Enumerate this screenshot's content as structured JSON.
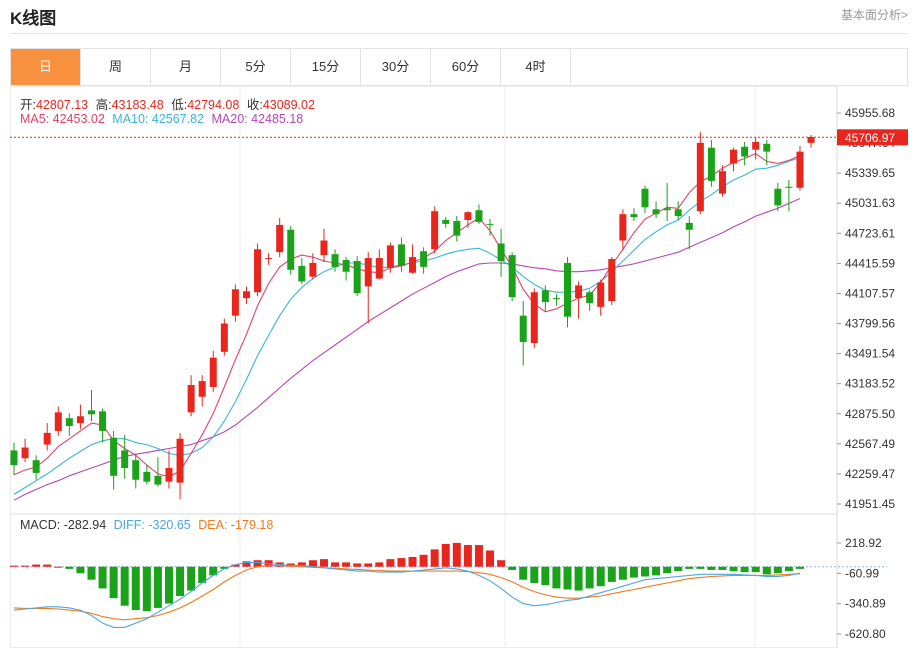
{
  "header": {
    "title": "K线图",
    "link": "基本面分析>"
  },
  "tabs": [
    {
      "label": "日",
      "active": true
    },
    {
      "label": "周"
    },
    {
      "label": "月"
    },
    {
      "label": "5分"
    },
    {
      "label": "15分"
    },
    {
      "label": "30分"
    },
    {
      "label": "60分"
    },
    {
      "label": "4时"
    }
  ],
  "ohlc_legend": {
    "open_label": "开:",
    "open": "42807.13",
    "high_label": "高:",
    "high": "43183.48",
    "low_label": "低:",
    "low": "42794.08",
    "close_label": "收:",
    "close": "43089.02"
  },
  "ma_legend": {
    "ma5": "MA5: 42453.02",
    "ma10": "MA10: 42567.82",
    "ma20": "MA20: 42485.18"
  },
  "macd_legend": {
    "macd": "MACD: -282.94",
    "diff": "DIFF: -320.65",
    "dea": "DEA: -179.18"
  },
  "colors": {
    "up": "#e8261e",
    "down": "#1aa21a",
    "ma5": "#e0426a",
    "ma10": "#38b6d8",
    "ma20": "#b547b5",
    "dea": "#f07b1e",
    "diff": "#4aa8e0",
    "accent": "#f7913f"
  },
  "chart_data": {
    "type": "candlestick",
    "price_axis": {
      "ticks": [
        "45955.68",
        "45647.64",
        "45339.65",
        "45031.63",
        "44723.61",
        "44415.59",
        "44107.57",
        "43799.56",
        "43491.54",
        "43183.52",
        "42875.50",
        "42567.49",
        "42259.47",
        "41951.45"
      ],
      "range": [
        41951.45,
        45955.68
      ]
    },
    "last_price_label": "45706.97",
    "last_price": 45706.97,
    "candles": [
      [
        42500,
        42350,
        42580,
        42250
      ],
      [
        42420,
        42530,
        42620,
        42380
      ],
      [
        42400,
        42270,
        42450,
        42200
      ],
      [
        42560,
        42680,
        42780,
        42500
      ],
      [
        42700,
        42890,
        42950,
        42650
      ],
      [
        42830,
        42750,
        42880,
        42650
      ],
      [
        42780,
        42850,
        42970,
        42720
      ],
      [
        42910,
        42870,
        43120,
        42800
      ],
      [
        42900,
        42700,
        42930,
        42580
      ],
      [
        42630,
        42240,
        42700,
        42100
      ],
      [
        42500,
        42320,
        42660,
        42210
      ],
      [
        42400,
        42200,
        42470,
        42110
      ],
      [
        42280,
        42180,
        42350,
        42150
      ],
      [
        42240,
        42150,
        42430,
        42130
      ],
      [
        42180,
        42320,
        42500,
        42110
      ],
      [
        42170,
        42620,
        42680,
        42000
      ],
      [
        42890,
        43170,
        43270,
        42850
      ],
      [
        43050,
        43210,
        43270,
        42950
      ],
      [
        43150,
        43450,
        43520,
        43100
      ],
      [
        43510,
        43800,
        43850,
        43470
      ],
      [
        43880,
        44150,
        44200,
        43820
      ],
      [
        44060,
        44130,
        44180,
        44000
      ],
      [
        44120,
        44560,
        44620,
        44080
      ],
      [
        44470,
        44470,
        44520,
        44400
      ],
      [
        44530,
        44810,
        44880,
        44480
      ],
      [
        44760,
        44350,
        44800,
        44300
      ],
      [
        44390,
        44230,
        44470,
        44200
      ],
      [
        44280,
        44420,
        44520,
        44250
      ],
      [
        44500,
        44650,
        44770,
        44430
      ],
      [
        44510,
        44380,
        44560,
        44330
      ],
      [
        44450,
        44330,
        44480,
        44240
      ],
      [
        44440,
        44110,
        44490,
        44080
      ],
      [
        44180,
        44470,
        44530,
        43800
      ],
      [
        44260,
        44470,
        44560,
        44250
      ],
      [
        44370,
        44600,
        44630,
        44320
      ],
      [
        44610,
        44390,
        44680,
        44330
      ],
      [
        44320,
        44480,
        44610,
        44310
      ],
      [
        44540,
        44380,
        44580,
        44310
      ],
      [
        44560,
        44950,
        45000,
        44520
      ],
      [
        44860,
        44820,
        44890,
        44780
      ],
      [
        44850,
        44700,
        44900,
        44640
      ],
      [
        44860,
        44940,
        44950,
        44780
      ],
      [
        44960,
        44840,
        45020,
        44820
      ],
      [
        44820,
        44810,
        44870,
        44700
      ],
      [
        44620,
        44440,
        44770,
        44280
      ],
      [
        44500,
        44070,
        44530,
        44030
      ],
      [
        43880,
        43610,
        44030,
        43370
      ],
      [
        43600,
        44120,
        44160,
        43550
      ],
      [
        44140,
        44020,
        44190,
        43920
      ],
      [
        44060,
        44050,
        44100,
        43980
      ],
      [
        44420,
        43870,
        44480,
        43760
      ],
      [
        44060,
        44190,
        44230,
        43850
      ],
      [
        44120,
        44010,
        44140,
        43930
      ],
      [
        43970,
        44220,
        44250,
        43880
      ],
      [
        44030,
        44460,
        44480,
        43990
      ],
      [
        44650,
        44920,
        44970,
        44550
      ],
      [
        44920,
        44890,
        44980,
        44850
      ],
      [
        45180,
        44990,
        45210,
        44930
      ],
      [
        44970,
        44920,
        45050,
        44880
      ],
      [
        44980,
        44960,
        45240,
        44850
      ],
      [
        44970,
        44900,
        45050,
        44860
      ],
      [
        44830,
        44760,
        44900,
        44560
      ],
      [
        44950,
        45650,
        45760,
        44920
      ],
      [
        45600,
        45260,
        45680,
        45200
      ],
      [
        45130,
        45360,
        45420,
        45100
      ],
      [
        45440,
        45580,
        45600,
        45360
      ],
      [
        45610,
        45510,
        45660,
        45420
      ],
      [
        45580,
        45660,
        45700,
        45480
      ],
      [
        45640,
        45560,
        45680,
        45420
      ],
      [
        45180,
        45010,
        45240,
        44950
      ],
      [
        45200,
        45190,
        45270,
        44950
      ],
      [
        45190,
        45560,
        45620,
        45160
      ],
      [
        45650,
        45710,
        45730,
        45600
      ]
    ],
    "ma5": [
      42250,
      42300,
      42330,
      42420,
      42540,
      42620,
      42700,
      42780,
      42760,
      42600,
      42520,
      42450,
      42350,
      42260,
      42230,
      42290,
      42470,
      42660,
      42880,
      43150,
      43430,
      43690,
      43980,
      44210,
      44380,
      44460,
      44500,
      44480,
      44440,
      44420,
      44400,
      44360,
      44330,
      44320,
      44370,
      44390,
      44430,
      44470,
      44540,
      44650,
      44730,
      44810,
      44880,
      44750,
      44560,
      44380,
      44150,
      44000,
      43920,
      43950,
      44010,
      44060,
      44090,
      44220,
      44400,
      44560,
      44730,
      44870,
      44930,
      44990,
      44980,
      45140,
      45250,
      45310,
      45390,
      45450,
      45490,
      45540,
      45460,
      45440,
      45470,
      45520
    ],
    "ma10": [
      42050,
      42120,
      42190,
      42260,
      42340,
      42420,
      42490,
      42560,
      42600,
      42620,
      42620,
      42580,
      42560,
      42520,
      42470,
      42450,
      42470,
      42530,
      42640,
      42800,
      43000,
      43230,
      43470,
      43680,
      43880,
      44050,
      44170,
      44260,
      44330,
      44380,
      44420,
      44420,
      44400,
      44370,
      44380,
      44400,
      44420,
      44440,
      44470,
      44510,
      44540,
      44560,
      44570,
      44520,
      44450,
      44380,
      44280,
      44200,
      44140,
      44120,
      44120,
      44130,
      44160,
      44230,
      44330,
      44440,
      44550,
      44660,
      44740,
      44810,
      44860,
      44960,
      45050,
      45120,
      45200,
      45270,
      45320,
      45380,
      45390,
      45420,
      45460,
      45500
    ],
    "ma20": [
      41990,
      42050,
      42100,
      42150,
      42190,
      42240,
      42280,
      42320,
      42360,
      42400,
      42440,
      42460,
      42480,
      42500,
      42520,
      42540,
      42560,
      42600,
      42640,
      42690,
      42760,
      42850,
      42940,
      43040,
      43140,
      43240,
      43330,
      43420,
      43500,
      43580,
      43660,
      43740,
      43820,
      43890,
      43960,
      44030,
      44100,
      44160,
      44220,
      44280,
      44330,
      44370,
      44410,
      44420,
      44420,
      44410,
      44390,
      44370,
      44360,
      44340,
      44330,
      44330,
      44340,
      44350,
      44370,
      44390,
      44410,
      44440,
      44470,
      44500,
      44530,
      44580,
      44630,
      44680,
      44730,
      44790,
      44840,
      44900,
      44940,
      44980,
      45030,
      45080
    ],
    "macd_axis": {
      "ticks": [
        "218.92",
        "-60.99",
        "-340.89",
        "-620.80"
      ],
      "range": [
        -620.8,
        218.92
      ]
    },
    "macd_hist": [
      10,
      10,
      20,
      20,
      0,
      -20,
      -60,
      -120,
      -200,
      -290,
      -360,
      -400,
      -410,
      -380,
      -340,
      -270,
      -220,
      -150,
      -80,
      -20,
      20,
      50,
      60,
      60,
      40,
      30,
      40,
      60,
      70,
      40,
      40,
      30,
      30,
      40,
      70,
      80,
      90,
      110,
      160,
      210,
      220,
      200,
      200,
      150,
      60,
      -30,
      -120,
      -150,
      -170,
      -200,
      -210,
      -220,
      -200,
      -180,
      -140,
      -120,
      -100,
      -90,
      -80,
      -60,
      -40,
      -20,
      -20,
      -30,
      -30,
      -40,
      -50,
      -50,
      -70,
      -60,
      -40,
      -20
    ],
    "diff": [
      -400,
      -390,
      -380,
      -370,
      -370,
      -380,
      -400,
      -450,
      -520,
      -560,
      -560,
      -520,
      -480,
      -420,
      -360,
      -300,
      -230,
      -150,
      -80,
      -20,
      20,
      40,
      40,
      30,
      20,
      10,
      10,
      0,
      -10,
      -20,
      -30,
      -40,
      -40,
      -50,
      -50,
      -50,
      -40,
      -30,
      -20,
      -10,
      -20,
      -40,
      -80,
      -130,
      -200,
      -280,
      -340,
      -360,
      -350,
      -330,
      -310,
      -300,
      -270,
      -240,
      -210,
      -180,
      -150,
      -120,
      -110,
      -100,
      -90,
      -80,
      -70,
      -70,
      -70,
      -70,
      -75,
      -80,
      -90,
      -90,
      -80,
      -60
    ],
    "dea": [
      -380,
      -385,
      -385,
      -385,
      -390,
      -400,
      -410,
      -430,
      -460,
      -480,
      -490,
      -480,
      -470,
      -450,
      -420,
      -380,
      -330,
      -270,
      -210,
      -140,
      -80,
      -30,
      0,
      10,
      10,
      5,
      0,
      -5,
      -10,
      -15,
      -20,
      -25,
      -30,
      -35,
      -40,
      -40,
      -40,
      -40,
      -40,
      -40,
      -40,
      -45,
      -55,
      -70,
      -100,
      -140,
      -190,
      -230,
      -260,
      -280,
      -290,
      -290,
      -280,
      -270,
      -250,
      -230,
      -210,
      -190,
      -170,
      -150,
      -130,
      -110,
      -100,
      -90,
      -85,
      -80,
      -80,
      -80,
      -80,
      -75,
      -70,
      -65
    ]
  }
}
